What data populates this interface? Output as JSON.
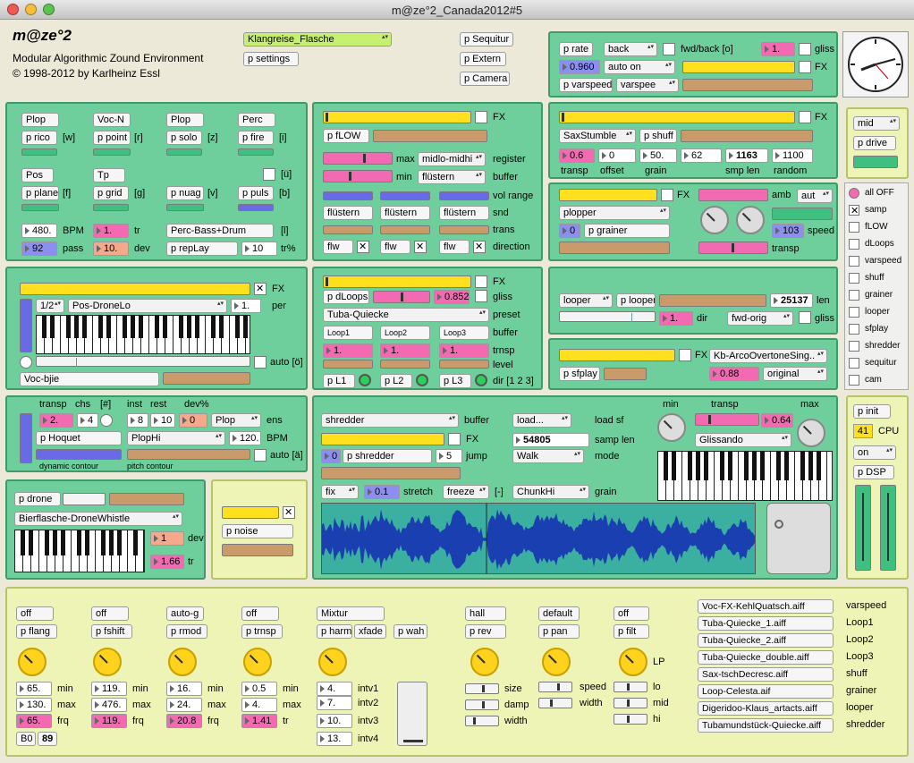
{
  "window": {
    "title": "m@ze°2_Canada2012#5"
  },
  "header": {
    "app_name": "m@ze°2",
    "subtitle": "Modular Algorithmic Zound Environment",
    "copyright": "© 1998-2012 by Karlheinz Essl",
    "preset": "Klangreise_Flasche",
    "settings": "p settings",
    "sequitur": "p Sequitur",
    "extern": "p Extern",
    "camera": "p Camera"
  },
  "rate": {
    "p_rate": "p rate",
    "back": "back",
    "fwdback": "fwd/back [o]",
    "val1": "1.",
    "gliss": "gliss",
    "num": "0.960",
    "autoon": "auto on",
    "fx": "FX",
    "varspeed": "p varspeed",
    "varspee": "varspee"
  },
  "gen": {
    "b1": "Plop",
    "b2": "Voc-N",
    "b3": "Plop",
    "b4": "Perc",
    "p1": "p rico",
    "k1": "[w]",
    "p2": "p point",
    "k2": "[r]",
    "p3": "p solo",
    "k3": "[z]",
    "p4": "p fire",
    "k4": "[i]",
    "b5": "Pos",
    "b6": "Tp",
    "ku": "[ü]",
    "p5": "p plane",
    "k5": "[f]",
    "p6": "p grid",
    "k6": "[g]",
    "p7": "p nuag",
    "k7": "[v]",
    "p8": "p puls",
    "k8": "[b]",
    "bpmval": "480.",
    "bpm": "BPM",
    "trval": "1.",
    "tr": "tr",
    "ensemble": "Perc-Bass+Drum",
    "kl": "[l]",
    "passval": "92",
    "pass": "pass",
    "devval": "10.",
    "dev": "dev",
    "replay": "p repLay",
    "trpval": "10",
    "trp": "tr%"
  },
  "flow": {
    "fx": "FX",
    "pflow": "p fLOW",
    "max": "max",
    "maxsel": "midlo-midhi",
    "register": "register",
    "min": "min",
    "minsel": "flüstern",
    "buffer": "buffer",
    "volrange": "vol range",
    "snd1": "flüstern",
    "snd2": "flüstern",
    "snd3": "flüstern",
    "snd": "snd",
    "trans": "trans",
    "f1": "flw",
    "f2": "flw",
    "f3": "flw",
    "direction": "direction"
  },
  "sax": {
    "fx": "FX",
    "preset": "SaxStumble",
    "shuff": "p shuff",
    "transpval": "0.6",
    "offsetval": "0",
    "grainval": "50.",
    "gv2": "62",
    "smplen": "1163",
    "random": "1100",
    "transp": "transp",
    "offset": "offset",
    "grain": "grain",
    "smplenl": "smp len",
    "randoml": "random"
  },
  "mid": {
    "sel": "mid",
    "drive": "p drive"
  },
  "grainer": {
    "fx": "FX",
    "amb": "amb",
    "aut": "aut",
    "preset": "plopper",
    "num0": "0",
    "pg": "p grainer",
    "speed": "speed",
    "speedval": "103",
    "transp": "transp"
  },
  "switches": [
    "all OFF",
    "samp",
    "fLOW",
    "dLoops",
    "varspeed",
    "shuff",
    "grainer",
    "looper",
    "sfplay",
    "shredder",
    "sequitur",
    "cam"
  ],
  "posdrone": {
    "fx": "FX",
    "ratio": "1/2",
    "preset": "Pos-DroneLo",
    "perval": "1.",
    "per": "per",
    "auto": "auto [ö]",
    "voc": "Voc-bjie"
  },
  "dloops": {
    "fx": "FX",
    "pd": "p dLoops",
    "num": "0.852",
    "gliss": "gliss",
    "preset": "Tuba-Quiecke",
    "presetl": "preset",
    "l1": "Loop1",
    "l2": "Loop2",
    "l3": "Loop3",
    "buffer": "buffer",
    "t1": "1.",
    "t2": "1.",
    "t3": "1.",
    "trnsp": "trnsp",
    "level": "level",
    "pl1": "p L1",
    "pl2": "p L2",
    "pl3": "p L3",
    "dir": "dir [1 2 3]"
  },
  "looper": {
    "looper": "looper",
    "plooper": "p looper",
    "len": "25137",
    "lenl": "len",
    "val": "1.",
    "dir": "dir",
    "sel": "fwd-orig",
    "gliss": "gliss"
  },
  "sfplay": {
    "fx": "FX",
    "preset": "Kb-ArcoOvertoneSing..",
    "psf": "p sfplay",
    "num": "0.88",
    "sel": "original"
  },
  "hoquet": {
    "transp": "transp",
    "chs": "chs",
    "hash": "[#]",
    "inst": "inst",
    "rest": "rest",
    "devp": "dev%",
    "tv": "2.",
    "cv": "4",
    "iv": "8",
    "rv": "10",
    "dv": "0",
    "ens": "Plop",
    "ensl": "ens",
    "ph": "p Hoquet",
    "pc": "PlopHi",
    "bpmv": "120.",
    "bpm": "BPM",
    "auto": "auto [ä]",
    "dyn": "dynamic contour",
    "pitch": "pitch contour"
  },
  "shredder": {
    "buffer_sel": "shredder",
    "buffer": "buffer",
    "load": "load...",
    "loadsf": "load sf",
    "fx": "FX",
    "samplen": "54805",
    "samplenl": "samp len",
    "zero": "0",
    "ps": "p shredder",
    "jump": "5",
    "jumpl": "jump",
    "walk": "Walk",
    "mode": "mode",
    "fix": "fix",
    "stretch": "0.1",
    "stretchl": "stretch",
    "freeze": "freeze",
    "dash": "[-]",
    "grain": "ChunkHi",
    "grainl": "grain",
    "min": "min",
    "transp": "transp",
    "max": "max",
    "tv": "0.64",
    "gliss": "Glissando"
  },
  "drone": {
    "pd": "p drone",
    "preset": "Bierflasche-DroneWhistle",
    "devv": "1",
    "dev": "dev",
    "trv": "1.66",
    "tr": "tr"
  },
  "noise": {
    "pn": "p noise"
  },
  "cpu": {
    "init": "p init",
    "val": "41",
    "cpu": "CPU",
    "on": "on",
    "dsp": "p DSP"
  },
  "fx": [
    {
      "sel": "off",
      "p": "p flang",
      "v1": "65.",
      "l1": "min",
      "v2": "130.",
      "l2": "max",
      "v3": "65.",
      "l3": "frq",
      "b0": "B0",
      "b1": "89"
    },
    {
      "sel": "off",
      "p": "p fshift",
      "v1": "119.",
      "l1": "min",
      "v2": "476.",
      "l2": "max",
      "v3": "119.",
      "l3": "frq"
    },
    {
      "sel": "auto-g",
      "p": "p rmod",
      "v1": "16.",
      "l1": "min",
      "v2": "24.",
      "l2": "max",
      "v3": "20.8",
      "l3": "frq"
    },
    {
      "sel": "off",
      "p": "p trnsp",
      "v1": "0.5",
      "l1": "min",
      "v2": "4.",
      "l2": "max",
      "v3": "1.41",
      "l3": "tr"
    }
  ],
  "harm": {
    "sel": "Mixtur",
    "p": "p harm",
    "xf": "xfade",
    "pw": "p wah",
    "i1": "4.",
    "l1": "intv1",
    "i2": "7.",
    "l2": "intv2",
    "i3": "10.",
    "l3": "intv3",
    "i4": "13.",
    "l4": "intv4"
  },
  "rev": {
    "sel": "hall",
    "p": "p rev",
    "size": "size",
    "damp": "damp",
    "width": "width"
  },
  "pan": {
    "sel": "default",
    "p": "p pan",
    "speed": "speed",
    "width": "width"
  },
  "filt": {
    "sel": "off",
    "p": "p filt",
    "lp": "LP",
    "lo": "lo",
    "mid": "mid",
    "hi": "hi"
  },
  "files": [
    {
      "f": "Voc-FX-KehlQuatsch.aiff",
      "l": "varspeed"
    },
    {
      "f": "Tuba-Quiecke_1.aiff",
      "l": "Loop1"
    },
    {
      "f": "Tuba-Quiecke_2.aiff",
      "l": "Loop2"
    },
    {
      "f": "Tuba-Quiecke_double.aiff",
      "l": "Loop3"
    },
    {
      "f": "Sax-tschDecresc.aiff",
      "l": "shuff"
    },
    {
      "f": "Loop-Celesta.aif",
      "l": "grainer"
    },
    {
      "f": "Digeridoo-Klaus_artacts.aiff",
      "l": "looper"
    },
    {
      "f": "Tubamundstück-Quiecke.aiff",
      "l": "shredder"
    }
  ],
  "colors": {
    "panel": "#6fcf9c",
    "panel_yellow": "#eef4b6",
    "slider_yellow": "#ffe01e",
    "slider_tan": "#c99a6a",
    "pink": "#f46ab2",
    "waveform": "#1a3fb0"
  }
}
